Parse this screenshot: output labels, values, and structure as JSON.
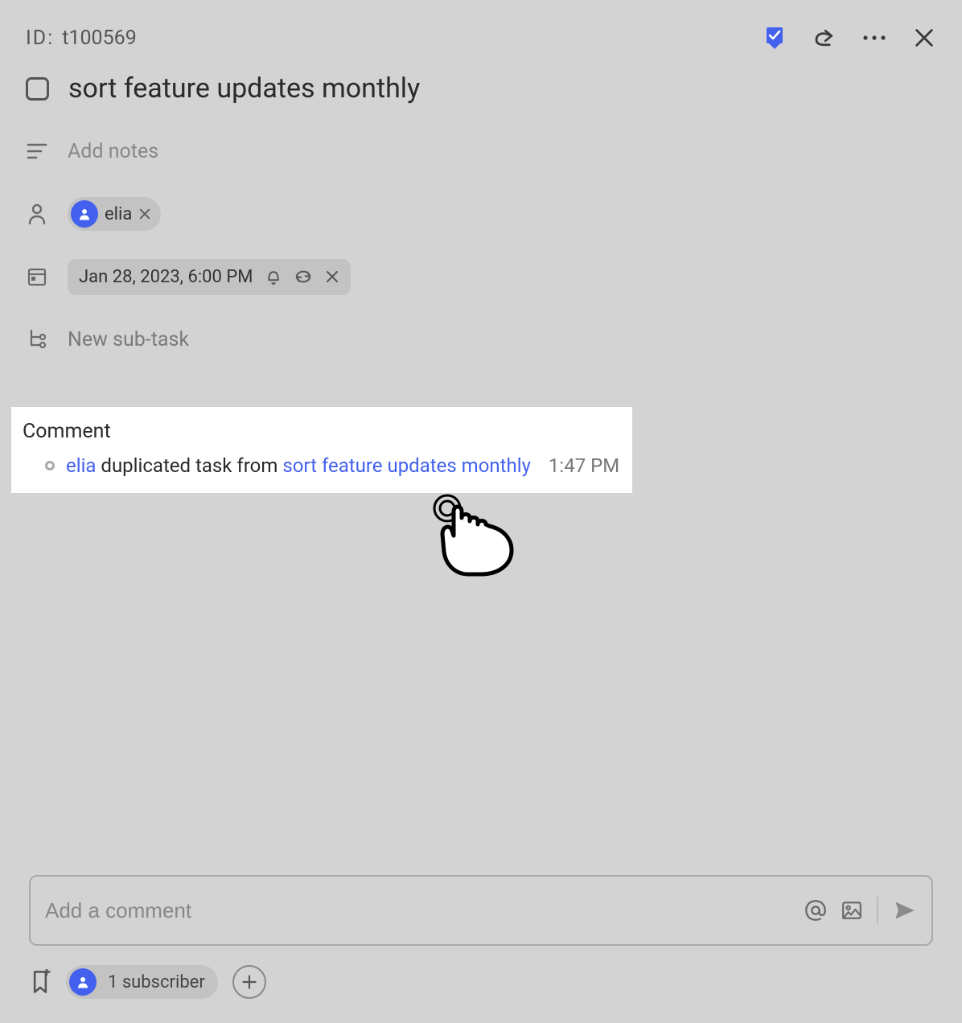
{
  "header": {
    "id_label": "ID:",
    "id_value": "t100569"
  },
  "task": {
    "title": "sort feature updates monthly"
  },
  "notes": {
    "placeholder": "Add notes"
  },
  "assignee": {
    "name": "elia"
  },
  "date": {
    "value": "Jan 28, 2023, 6:00 PM"
  },
  "subtask": {
    "label": "New sub-task"
  },
  "comment_section": {
    "heading": "Comment",
    "activity": {
      "user": "elia",
      "text": " duplicated task from ",
      "linked_task": "sort feature updates monthly",
      "time": "1:47 PM"
    }
  },
  "comment_input": {
    "placeholder": "Add a comment"
  },
  "subscribers": {
    "count_label": "1 subscriber"
  }
}
